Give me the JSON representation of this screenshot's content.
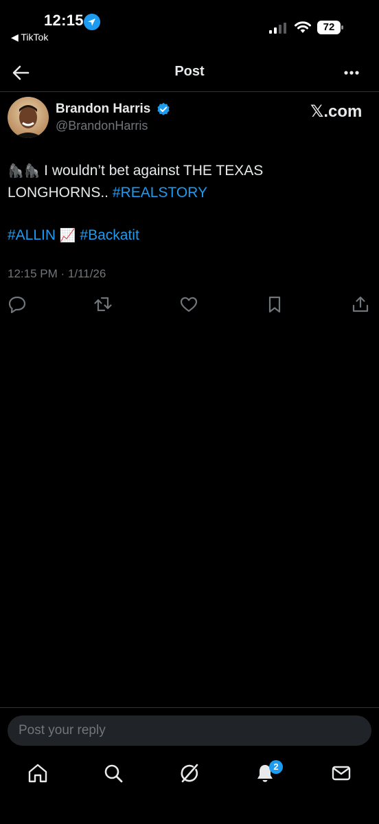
{
  "status_bar": {
    "time": "12:15",
    "back_app": "◀ TikTok",
    "battery": "72"
  },
  "nav": {
    "title": "Post"
  },
  "post": {
    "author_name": "Brandon Harris",
    "author_handle": "@BrandonHarris",
    "source_label": "𝕏.com",
    "emojis": "🦍🦍",
    "text_main": " I wouldn’t bet against THE TEXAS LONGHORNS.. ",
    "hashtag_1": "#REALSTORY",
    "hashtag_2": "#ALLIN",
    "chart_emoji": "📈",
    "hashtag_3": "#Backatit",
    "timestamp": "12:15 PM · 1/11/26"
  },
  "actions": [
    "reply-icon",
    "repost-icon",
    "like-icon",
    "bookmark-icon",
    "share-icon"
  ],
  "reply": {
    "placeholder": "Post your reply"
  },
  "tabbar": {
    "items": [
      "home-icon",
      "search-icon",
      "grok-icon",
      "notifications-icon",
      "messages-icon"
    ],
    "notification_count": "2"
  },
  "colors": {
    "accent": "#1d9bf0",
    "background": "#000000",
    "text": "#e7e9ea",
    "muted": "#71767b"
  }
}
